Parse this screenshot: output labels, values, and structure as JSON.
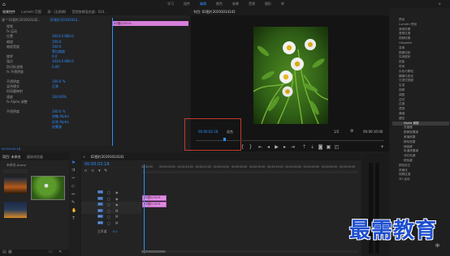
{
  "menubar": {
    "items": [
      "学习",
      "组件",
      "编辑",
      "颜色",
      "效果",
      "音频",
      "图形",
      "库"
    ],
    "active_index": 2
  },
  "left_panel": {
    "tabs": [
      "效果控件",
      "Lumetri 范围",
      "源：(无剪辑)",
      "音频剪辑混合器：024..."
    ],
    "source_label": "源 * 02图片201910142...",
    "sequence_label": "02图片20191014...",
    "clip_label": "02图片2019...",
    "rows": [
      {
        "label": "视频",
        "value": ""
      },
      {
        "label": "fx 运动",
        "value": ""
      },
      {
        "label": "位置",
        "value": "1024.0   680.0"
      },
      {
        "label": "缩放",
        "value": "100.0"
      },
      {
        "label": "缩放宽度",
        "value": "100.0"
      },
      {
        "label": "",
        "value": "等比缩放"
      },
      {
        "label": "旋转",
        "value": "0.0"
      },
      {
        "label": "锚点",
        "value": "1024.0   680.0"
      },
      {
        "label": "防闪烁滤镜",
        "value": "0.00"
      },
      {
        "label": "fx 不透明度",
        "value": ""
      },
      {
        "label": "",
        "value": ""
      },
      {
        "label": "不透明度",
        "value": "100.0 %"
      },
      {
        "label": "混合模式",
        "value": "正常"
      },
      {
        "label": "时间重映射",
        "value": ""
      },
      {
        "label": "速度",
        "value": "100.00%"
      },
      {
        "label": "fx Alpha 调整",
        "value": ""
      },
      {
        "label": "",
        "value": ""
      },
      {
        "label": "不透明度",
        "value": "100.0 %"
      },
      {
        "label": "",
        "value": "忽略 Alpha"
      },
      {
        "label": "",
        "value": "反转 Alpha"
      },
      {
        "label": "",
        "value": "仅蒙版"
      }
    ],
    "timecode": "00:00:02:18"
  },
  "program_monitor": {
    "tab": "节目: 02图片20191014141",
    "timecode": "00:00:02:18",
    "fit_label": "适合",
    "quality_label": "1/2",
    "duration": "00:00:10:00"
  },
  "project_panel": {
    "tabs": [
      "项目: 未命名",
      "媒体浏览器",
      "库"
    ],
    "project_name": "未命名.prproj",
    "items": [
      {
        "name": "02图片1",
        "duration": "5:00"
      },
      {
        "name": "02图片2019...",
        "duration": "5:00"
      },
      {
        "name": "02图片3",
        "duration": "5:00"
      }
    ]
  },
  "timeline": {
    "tab": "02图片20191014141",
    "timecode": "00:00:02:18",
    "ruler": [
      "00:00:00",
      "00:00:05:00",
      "00:00:10:00",
      "00:00:15:00",
      "00:00:20:00",
      "00:00:25:00",
      "00:00:30:00",
      "00:00:35:00",
      "00:00:40:00",
      "00:00:45:00",
      "00:00:50:00",
      "00:00:55:00"
    ],
    "tracks": [
      "V3",
      "V2",
      "V1",
      "A1",
      "A2",
      "A3"
    ],
    "master_label": "主声道",
    "master_value": "0.0",
    "clips": [
      {
        "name": "02图片2019...",
        "track": "V2"
      },
      {
        "name": "02图片2019...",
        "track": "V1"
      }
    ]
  },
  "effects_panel": {
    "items": [
      "预设",
      "Lumetri 预设",
      "音频效果",
      "音频过渡",
      "视频效果",
      "Obsolete",
      "变换",
      "图像控制",
      "实用程序",
      "扭曲",
      "时间",
      "杂色与颗粒",
      "模糊与锐化",
      "沉浸式视频",
      "生成",
      "视频",
      "调整",
      "过时",
      "过渡",
      "透视",
      "通道",
      "键控",
      "Alpha 调整",
      "亮度键",
      "图像遮罩键",
      "差值遮罩",
      "移除遮罩",
      "超级键",
      "轨道遮罩键",
      "非红色键",
      "颜色键",
      "颜色校正",
      "风格化",
      "视频过渡",
      "3D 运动"
    ],
    "highlight": "Alpha 调整"
  },
  "watermark": {
    "text": "最需教育",
    "sub": "中"
  }
}
